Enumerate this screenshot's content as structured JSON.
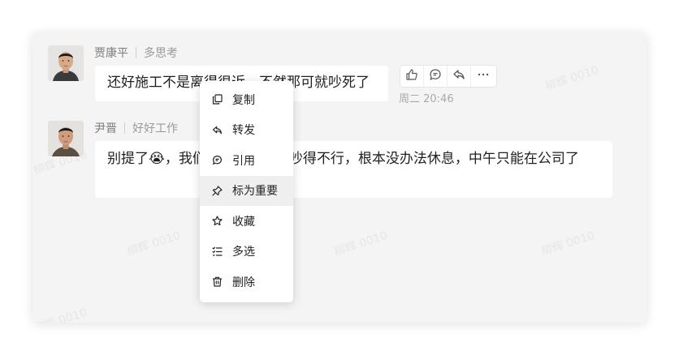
{
  "watermark_text": "柳辉 0010",
  "messages": [
    {
      "sender": "贾康平",
      "tag": "多思考",
      "text": "还好施工不是离得很近，不然那可就吵死了"
    },
    {
      "sender": "尹晋",
      "tag": "好好工作",
      "text_before": "别提了",
      "emoji": "😭",
      "text_after": "，我们楼下在装修，吵得不行，根本没办法休息，中午只能在公司了"
    }
  ],
  "toolbar": {
    "icons": [
      "thumbs-up-icon",
      "quote-icon",
      "forward-icon",
      "more-icon"
    ]
  },
  "timestamp": "周二 20:46",
  "context_menu": {
    "items": [
      {
        "label": "复制",
        "icon": "copy-icon"
      },
      {
        "label": "转发",
        "icon": "forward-icon"
      },
      {
        "label": "引用",
        "icon": "quote-icon"
      },
      {
        "label": "标为重要",
        "icon": "pin-icon",
        "active": true
      },
      {
        "label": "收藏",
        "icon": "star-icon"
      },
      {
        "label": "多选",
        "icon": "multi-select-icon"
      },
      {
        "label": "删除",
        "icon": "trash-icon"
      }
    ]
  }
}
